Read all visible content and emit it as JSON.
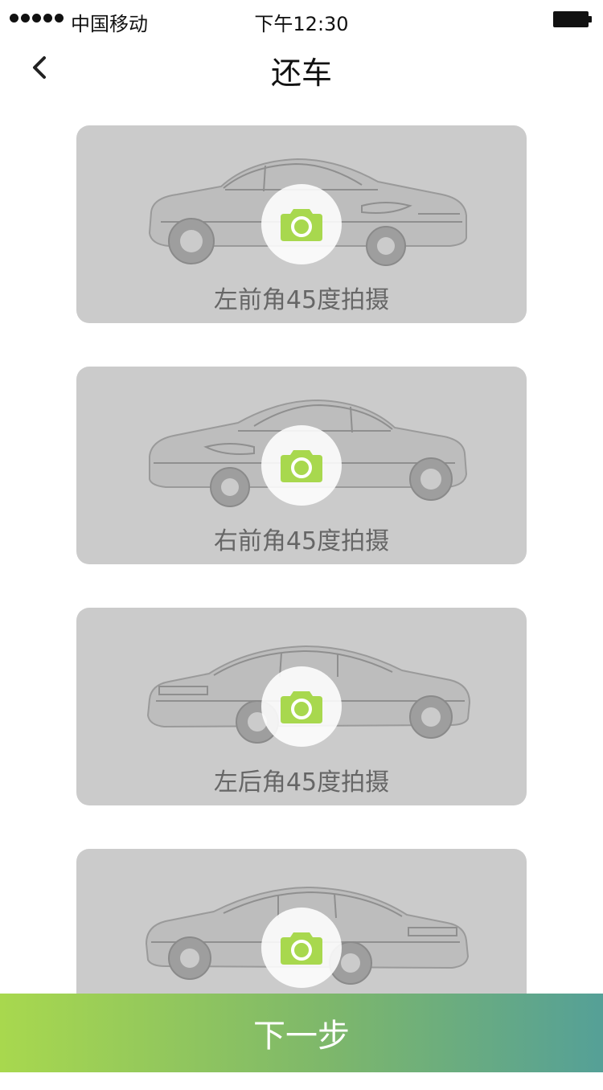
{
  "status_bar": {
    "carrier": "中国移动",
    "time": "下午12:30"
  },
  "header": {
    "title": "还车"
  },
  "photo_slots": [
    {
      "label": "左前角45度拍摄",
      "orientation": "left-front"
    },
    {
      "label": "右前角45度拍摄",
      "orientation": "right-front"
    },
    {
      "label": "左后角45度拍摄",
      "orientation": "left-rear"
    },
    {
      "label": "",
      "orientation": "right-rear"
    }
  ],
  "footer": {
    "next_label": "下一步"
  },
  "colors": {
    "accent_green": "#a8d84e",
    "accent_teal": "#55a097",
    "card_bg": "#cbcbcb"
  }
}
